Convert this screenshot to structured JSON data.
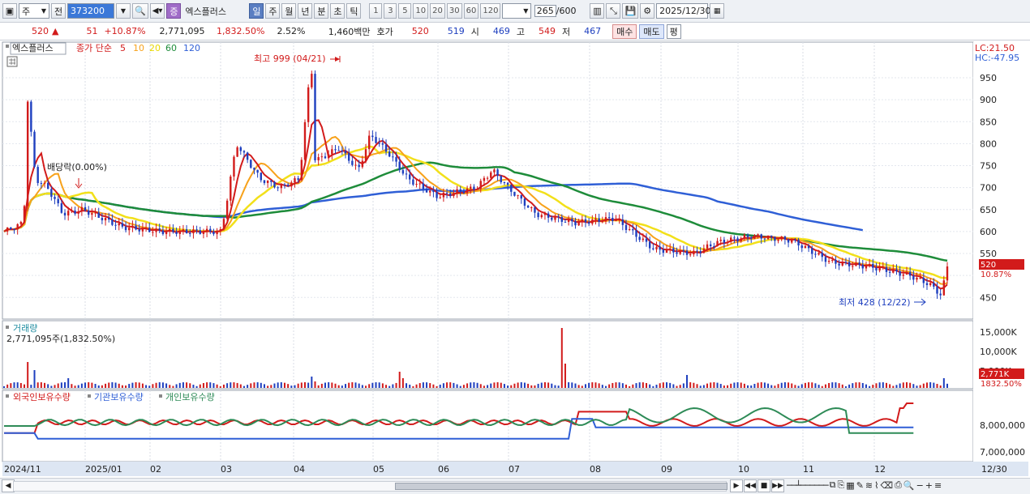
{
  "toolbar": {
    "window_icon": "window-icon",
    "market_select": "주",
    "prev_label": "전",
    "stock_code": "373200",
    "stock_name": "엑스플러스",
    "stock_prefix": "증",
    "periods": [
      "일",
      "주",
      "월",
      "년",
      "분",
      "초",
      "틱"
    ],
    "active_period": "일",
    "interval_buttons": [
      "1",
      "3",
      "5",
      "10",
      "20",
      "30",
      "60",
      "120"
    ],
    "count_value": "265",
    "count_total": "/600",
    "date_value": "2025/12/30"
  },
  "info": {
    "price": "520",
    "change": "51",
    "change_pct": "+10.87%",
    "volume": "2,771,095",
    "volume_pct": "1,832.50%",
    "turnover_pct": "2.52%",
    "amount": "1,460백만",
    "quote_label": "호가",
    "ask": "520",
    "bid": "519",
    "open_label": "시",
    "open": "469",
    "high_label": "고",
    "high": "549",
    "low_label": "저",
    "low": "467",
    "buy_label": "매수",
    "sell_label": "매도",
    "flat_label": "평"
  },
  "price_pane": {
    "stock_tag": "엑스플러스",
    "ma_label": "종가 단순",
    "ma_periods": [
      {
        "label": "5",
        "color": "#d21b1b"
      },
      {
        "label": "10",
        "color": "#f7a21b"
      },
      {
        "label": "20",
        "color": "#f2e01a"
      },
      {
        "label": "60",
        "color": "#1e8c3a"
      },
      {
        "label": "120",
        "color": "#2f5fd6"
      }
    ],
    "lc_label": "LC:21.50",
    "hc_label": "HC:-47.95",
    "high_annotation": "최고 999 (04/21)",
    "low_annotation": "최저 428 (12/22)",
    "dividend_annotation": "배당락(0.00%)",
    "current_price_tag": "520",
    "current_pct_tag": "10.87%",
    "y_ticks": [
      "950",
      "900",
      "850",
      "800",
      "750",
      "700",
      "650",
      "600",
      "550",
      "450"
    ]
  },
  "volume_pane": {
    "title": "거래량",
    "value_label": "2,771,095주(1,832.50%)",
    "y_ticks": [
      "15,000K",
      "10,000K",
      "5,000K"
    ],
    "current_tag": "2,771K",
    "current_pct_tag": "1832.50%"
  },
  "holding_pane": {
    "series": [
      {
        "label": "외국인보유수량",
        "color": "#d21b1b"
      },
      {
        "label": "기관보유수량",
        "color": "#2f5fd6"
      },
      {
        "label": "개인보유수량",
        "color": "#2e8b57"
      }
    ],
    "y_ticks": [
      "8,000,000",
      "7,000,000"
    ]
  },
  "x_axis": {
    "labels": [
      "2024/11",
      "2025/01",
      "02",
      "03",
      "04",
      "05",
      "06",
      "07",
      "08",
      "09",
      "10",
      "11",
      "12",
      "12/30"
    ]
  },
  "colors": {
    "up": "#d21b1b",
    "down": "#1e3fbf",
    "ma5": "#d21b1b",
    "ma10": "#f7a21b",
    "ma20": "#f2e01a",
    "ma60": "#1e8c3a",
    "ma120": "#2f5fd6"
  }
}
